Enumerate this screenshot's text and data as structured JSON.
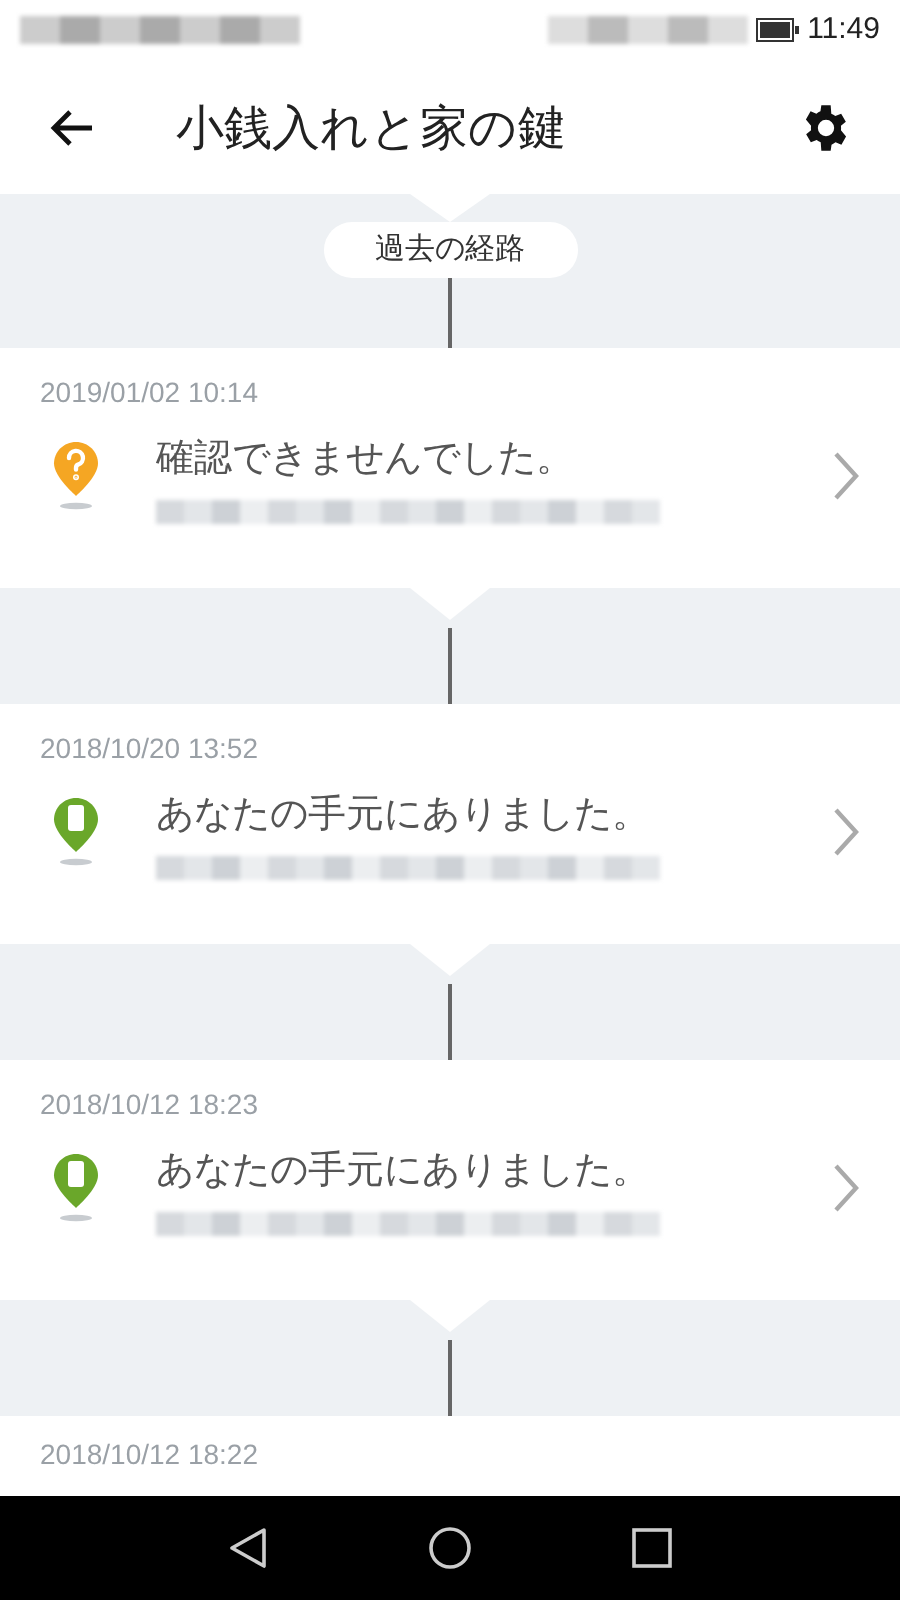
{
  "status_bar": {
    "time": "11:49"
  },
  "header": {
    "title": "小銭入れと家の鍵"
  },
  "section_label": "過去の経路",
  "entries": [
    {
      "date": "2019/01/02 10:14",
      "kind": "unknown",
      "message": "確認できませんでした。"
    },
    {
      "date": "2018/10/20 13:52",
      "kind": "in_hand",
      "message": "あなたの手元にありました。"
    },
    {
      "date": "2018/10/12 18:23",
      "kind": "in_hand",
      "message": "あなたの手元にありました。"
    },
    {
      "date": "2018/10/12 18:22"
    }
  ]
}
